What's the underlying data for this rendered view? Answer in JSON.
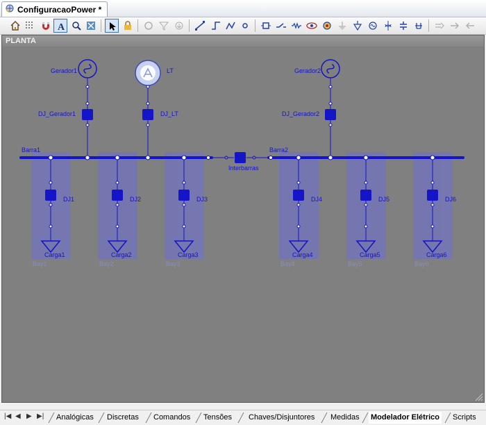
{
  "window": {
    "tab_title": "ConfiguracaoPower *"
  },
  "toolbar": {
    "buttons": [
      "home-icon",
      "grid-icon",
      "magnet-icon",
      "text-icon",
      "zoom-icon",
      "fit-icon",
      "pointer-icon",
      "lock-icon",
      "circle-icon",
      "filter-icon",
      "download-icon",
      "line-icon",
      "step-line-icon",
      "curve-icon",
      "node-icon",
      "breaker-icon",
      "switch-icon",
      "resistor-icon",
      "eye-icon",
      "source-icon",
      "ground-icon",
      "load-icon",
      "generator-icon",
      "transformer-icon",
      "busbar-icon",
      "capacitor-icon",
      "arrow-group-icon",
      "arrow-right-icon",
      "arrow-left-icon"
    ]
  },
  "canvas": {
    "title": "PLANTA",
    "background": "#808080",
    "element_color": "#1414c8",
    "bay_color": "#7878b4"
  },
  "diagram": {
    "busbars": {
      "barra1": "Barra1",
      "barra2": "Barra2"
    },
    "sources": {
      "gerador1": "Gerador1",
      "lt": "LT",
      "gerador2": "Gerador2"
    },
    "breakers": {
      "dj_gerador1": "DJ_Gerador1",
      "dj_lt": "DJ_LT",
      "dj_gerador2": "DJ_Gerador2",
      "interbarras": "Interbarras",
      "dj1": "DJ1",
      "dj2": "DJ2",
      "dj3": "DJ3",
      "dj4": "DJ4",
      "dj5": "DJ5",
      "dj6": "DJ6"
    },
    "loads": {
      "carga1": "Carga1",
      "carga2": "Carga2",
      "carga3": "Carga3",
      "carga4": "Carga4",
      "carga5": "Carga5",
      "carga6": "Carga6"
    },
    "bays": {
      "bay1": "Bay1",
      "bay2": "Bay2",
      "bay3": "Bay3",
      "bay4": "Bay4",
      "bay5": "Bay5",
      "bay6": "Bay6"
    }
  },
  "sheet_tabs": [
    "Analógicas",
    "Discretas",
    "Comandos",
    "Tensões",
    "Chaves/Disjuntores",
    "Medidas",
    "Modelador Elétrico",
    "Scripts"
  ],
  "active_sheet": "Modelador Elétrico",
  "nav_buttons": [
    "first-icon",
    "prev-icon",
    "next-icon",
    "last-icon"
  ]
}
